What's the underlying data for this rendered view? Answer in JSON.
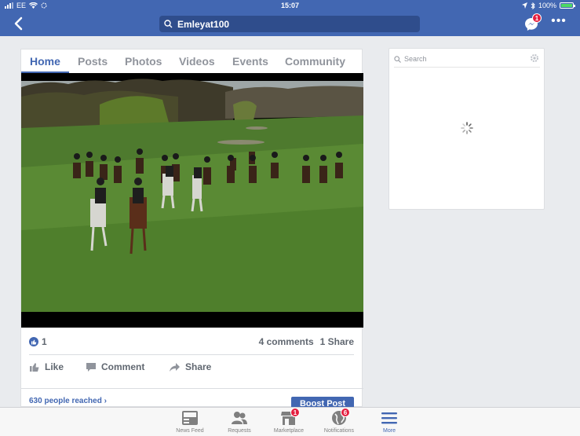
{
  "status_bar": {
    "carrier": "EE",
    "time": "15:07",
    "battery": "100%"
  },
  "nav": {
    "search_query": "Emleyat100",
    "messenger_badge": "1"
  },
  "page_tabs": [
    {
      "label": "Home",
      "active": true
    },
    {
      "label": "Posts",
      "active": false
    },
    {
      "label": "Photos",
      "active": false
    },
    {
      "label": "Videos",
      "active": false
    },
    {
      "label": "Events",
      "active": false
    },
    {
      "label": "Community",
      "active": false
    }
  ],
  "post": {
    "like_count": "1",
    "comments": "4 comments",
    "shares": "1 Share",
    "actions": {
      "like": "Like",
      "comment": "Comment",
      "share": "Share"
    },
    "reach": "630 people reached",
    "boost_button": "Boost Post"
  },
  "side_panel": {
    "search_placeholder": "Search"
  },
  "bottom_tabs": [
    {
      "label": "News Feed",
      "icon": "news-feed-icon",
      "badge": ""
    },
    {
      "label": "Requests",
      "icon": "friends-icon",
      "badge": ""
    },
    {
      "label": "Marketplace",
      "icon": "marketplace-icon",
      "badge": "1"
    },
    {
      "label": "Notifications",
      "icon": "globe-icon",
      "badge": "6"
    },
    {
      "label": "More",
      "icon": "hamburger-icon",
      "badge": ""
    }
  ],
  "colors": {
    "brand_blue": "#4267b2",
    "background": "#e9ebee",
    "badge_red": "#e41e3f"
  }
}
